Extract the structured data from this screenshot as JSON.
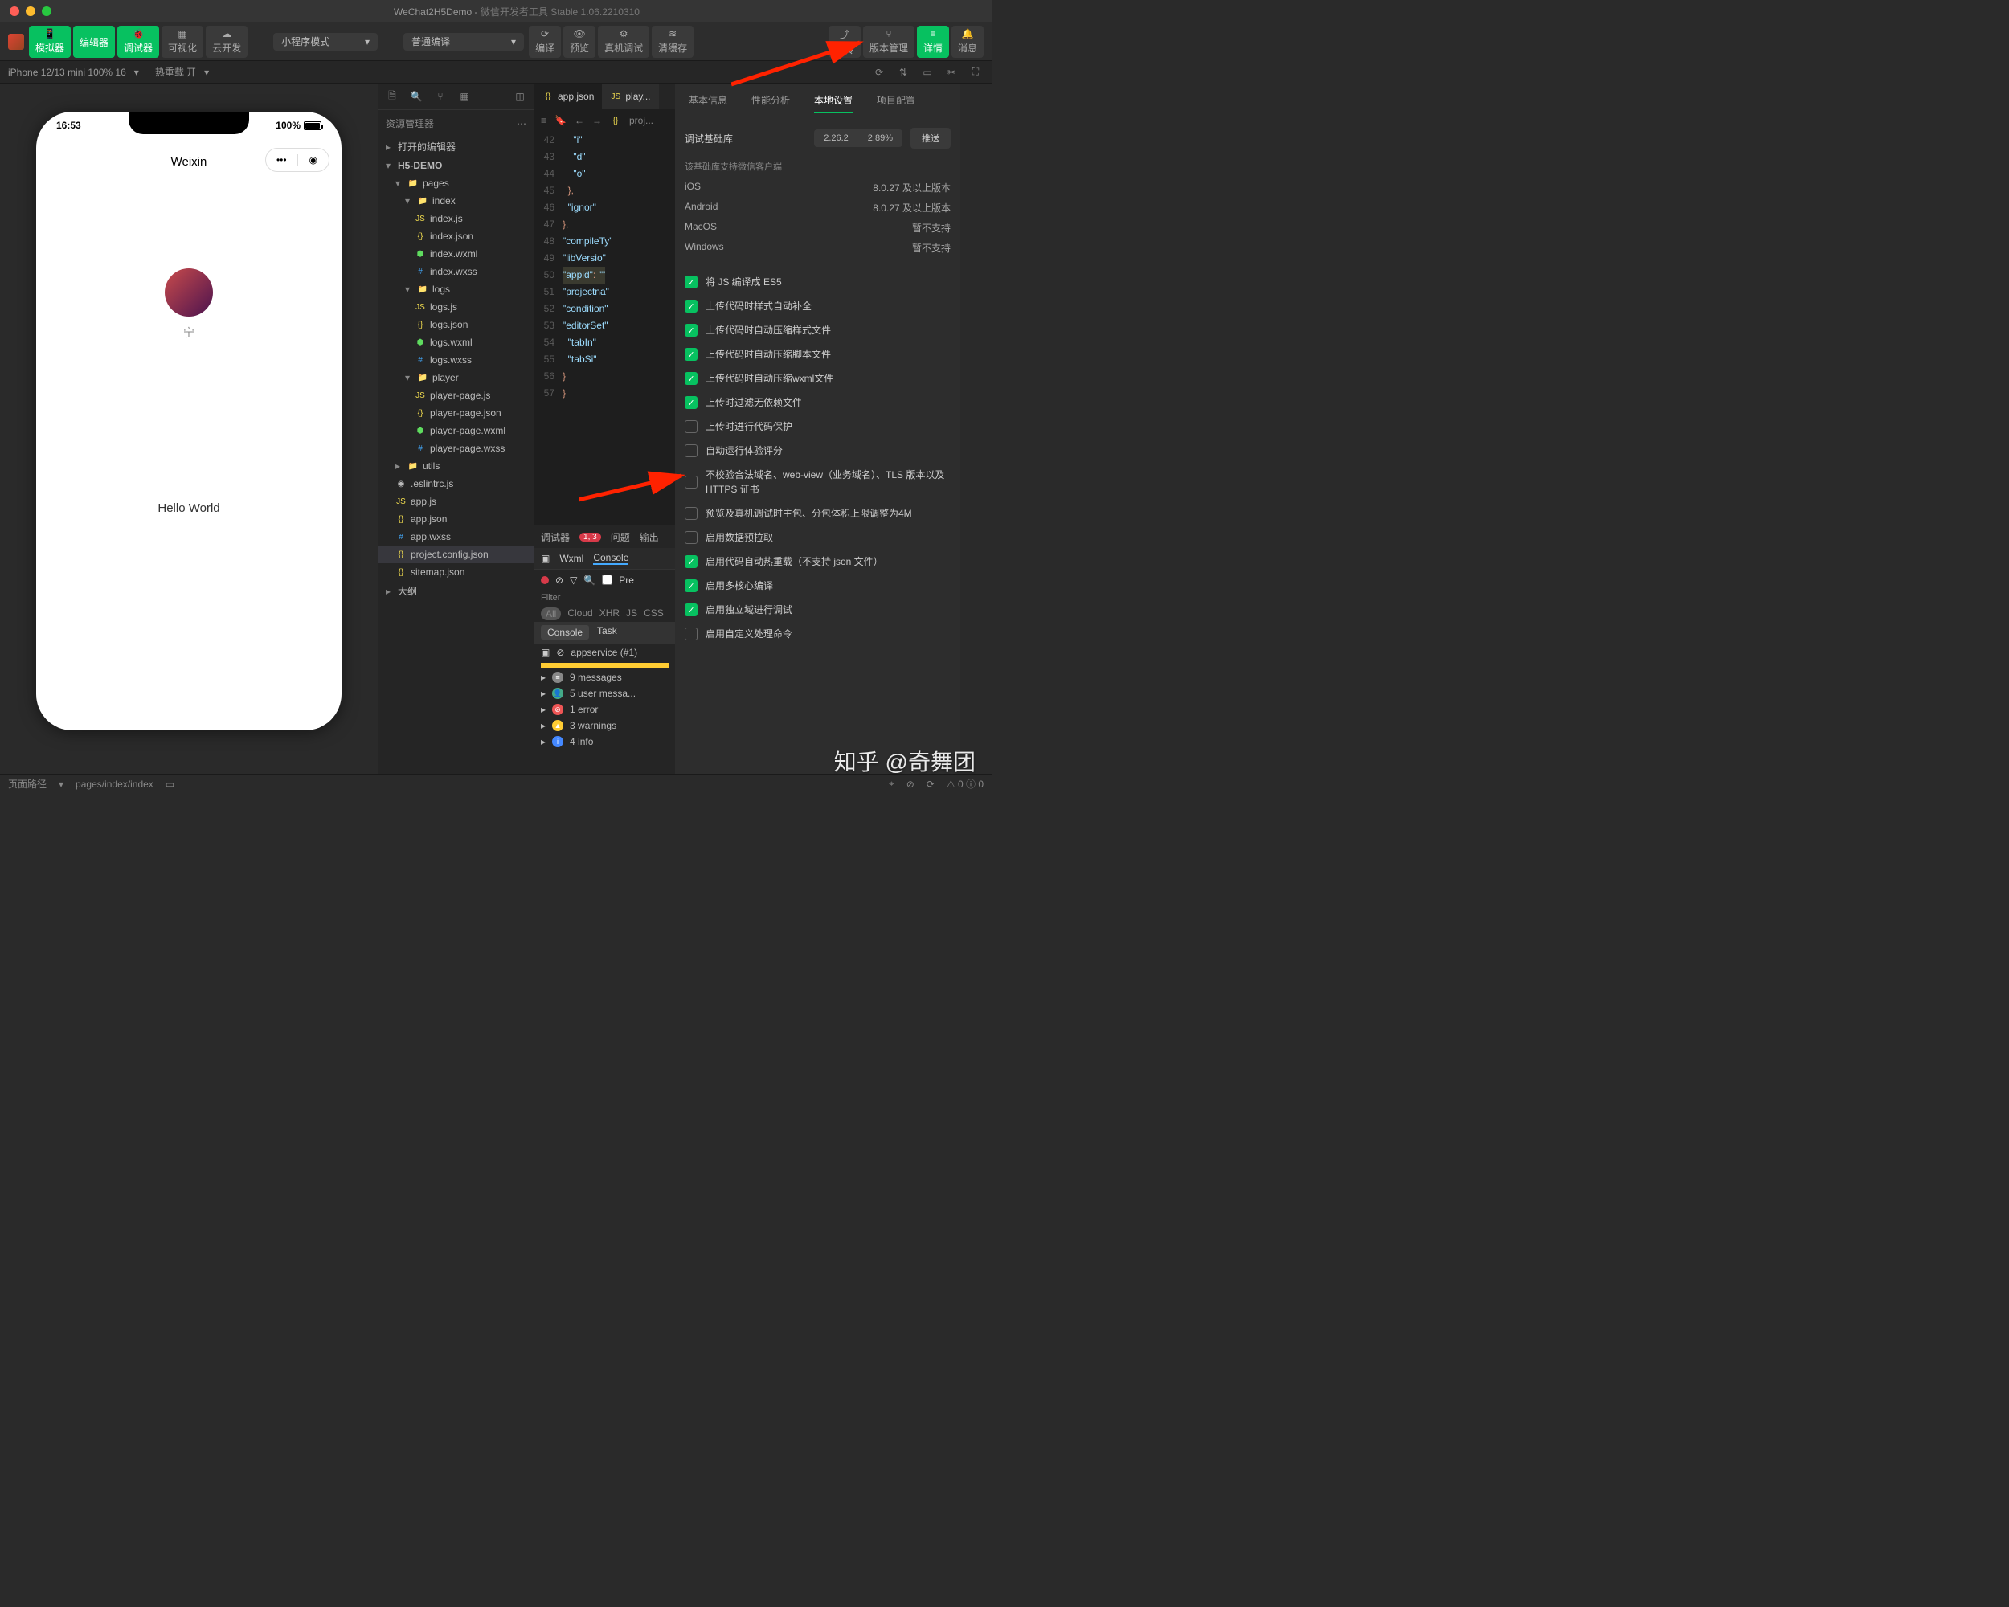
{
  "title": {
    "project": "WeChat2H5Demo",
    "app": "微信开发者工具 Stable 1.06.2210310"
  },
  "toolbar": {
    "left": [
      {
        "l": "模拟器"
      },
      {
        "l": "编辑器"
      },
      {
        "l": "调试器"
      },
      {
        "l": "可视化"
      },
      {
        "l": "云开发"
      }
    ],
    "mode": "小程序模式",
    "compile": "普通编译",
    "mid": [
      {
        "l": "编译"
      },
      {
        "l": "预览"
      },
      {
        "l": "真机调试"
      },
      {
        "l": "清缓存"
      }
    ],
    "right": [
      {
        "l": "上传"
      },
      {
        "l": "版本管理"
      },
      {
        "l": "详情"
      },
      {
        "l": "消息"
      }
    ]
  },
  "subbar": {
    "device": "iPhone 12/13 mini 100% 16",
    "hot": "热重载 开"
  },
  "phone": {
    "time": "16:53",
    "battery": "100%",
    "nav": "Weixin",
    "nick": "宁",
    "hello": "Hello World"
  },
  "explorer": {
    "title": "资源管理器",
    "open": "打开的编辑器",
    "root": "H5-DEMO",
    "outline": "大纲",
    "tree": [
      {
        "n": "pages",
        "t": "folder",
        "i": 1,
        "exp": true
      },
      {
        "n": "index",
        "t": "folder",
        "i": 2,
        "exp": true
      },
      {
        "n": "index.js",
        "t": "js",
        "i": 3
      },
      {
        "n": "index.json",
        "t": "json",
        "i": 3
      },
      {
        "n": "index.wxml",
        "t": "wxml",
        "i": 3
      },
      {
        "n": "index.wxss",
        "t": "wxss",
        "i": 3
      },
      {
        "n": "logs",
        "t": "folder",
        "i": 2,
        "exp": true
      },
      {
        "n": "logs.js",
        "t": "js",
        "i": 3
      },
      {
        "n": "logs.json",
        "t": "json",
        "i": 3
      },
      {
        "n": "logs.wxml",
        "t": "wxml",
        "i": 3
      },
      {
        "n": "logs.wxss",
        "t": "wxss",
        "i": 3
      },
      {
        "n": "player",
        "t": "folder",
        "i": 2,
        "exp": true
      },
      {
        "n": "player-page.js",
        "t": "js",
        "i": 3
      },
      {
        "n": "player-page.json",
        "t": "json",
        "i": 3
      },
      {
        "n": "player-page.wxml",
        "t": "wxml",
        "i": 3
      },
      {
        "n": "player-page.wxss",
        "t": "wxss",
        "i": 3
      },
      {
        "n": "utils",
        "t": "folder",
        "i": 1,
        "exp": false
      },
      {
        "n": ".eslintrc.js",
        "t": "eslint",
        "i": 1
      },
      {
        "n": "app.js",
        "t": "js",
        "i": 1
      },
      {
        "n": "app.json",
        "t": "json",
        "i": 1
      },
      {
        "n": "app.wxss",
        "t": "wxss",
        "i": 1
      },
      {
        "n": "project.config.json",
        "t": "json",
        "i": 1,
        "sel": true
      },
      {
        "n": "sitemap.json",
        "t": "json",
        "i": 1
      }
    ]
  },
  "editor": {
    "tabs": [
      {
        "n": "app.json"
      },
      {
        "n": "play..."
      }
    ],
    "crumb": "proj...",
    "lines": [
      {
        "g": 42,
        "t": "    \"i"
      },
      {
        "g": 43,
        "t": "    \"d"
      },
      {
        "g": 44,
        "t": "    \"o"
      },
      {
        "g": 45,
        "t": "  },"
      },
      {
        "g": 46,
        "t": "  \"ignor"
      },
      {
        "g": 47,
        "t": "},"
      },
      {
        "g": 48,
        "t": "\"compileTy"
      },
      {
        "g": 49,
        "t": "\"libVersio"
      },
      {
        "g": 50,
        "t": "\"appid\": \"",
        "hl": true
      },
      {
        "g": 51,
        "t": "\"projectna"
      },
      {
        "g": 52,
        "t": "\"condition"
      },
      {
        "g": 53,
        "t": "\"editorSet"
      },
      {
        "g": 54,
        "t": "  \"tabIn"
      },
      {
        "g": 55,
        "t": "  \"tabSi"
      },
      {
        "g": 56,
        "t": "}"
      },
      {
        "g": 57,
        "t": "}"
      }
    ]
  },
  "debugger": {
    "tab": "调试器",
    "badge": "1, 3",
    "issue": "问题",
    "out": "输出",
    "devtabs": [
      "Wxml",
      "Console"
    ],
    "contabs": [
      {
        "n": "Console",
        "act": true
      },
      {
        "n": "Task"
      }
    ],
    "filter": "Filter",
    "cats": [
      "All",
      "Cloud",
      "XHR",
      "JS",
      "CSS"
    ],
    "svc": "appservice (#1)",
    "pre": "Pre",
    "msgs": [
      {
        "ico": "≡",
        "c": "#888",
        "t": "9 messages"
      },
      {
        "ico": "👤",
        "c": "#4a8",
        "t": "5 user messa..."
      },
      {
        "ico": "⊘",
        "c": "#e55",
        "t": "1 error"
      },
      {
        "ico": "▲",
        "c": "#fc3",
        "t": "3 warnings"
      },
      {
        "ico": "i",
        "c": "#48f",
        "t": "4 info"
      }
    ]
  },
  "panel": {
    "tabs": [
      "基本信息",
      "性能分析",
      "本地设置",
      "项目配置"
    ],
    "active": 2,
    "liblabel": "调试基础库",
    "ver": "2.26.2",
    "pct": "2.89%",
    "push": "推送",
    "support": "该基础库支持微信客户端",
    "plats": [
      {
        "n": "iOS",
        "v": "8.0.27 及以上版本"
      },
      {
        "n": "Android",
        "v": "8.0.27 及以上版本"
      },
      {
        "n": "MacOS",
        "v": "暂不支持"
      },
      {
        "n": "Windows",
        "v": "暂不支持"
      }
    ],
    "checks": [
      {
        "on": true,
        "t": "将 JS 编译成 ES5"
      },
      {
        "on": true,
        "t": "上传代码时样式自动补全"
      },
      {
        "on": true,
        "t": "上传代码时自动压缩样式文件"
      },
      {
        "on": true,
        "t": "上传代码时自动压缩脚本文件"
      },
      {
        "on": true,
        "t": "上传代码时自动压缩wxml文件"
      },
      {
        "on": true,
        "t": "上传时过滤无依赖文件"
      },
      {
        "on": false,
        "t": "上传时进行代码保护"
      },
      {
        "on": false,
        "t": "自动运行体验评分"
      },
      {
        "on": false,
        "t": "不校验合法域名、web-view（业务域名）、TLS 版本以及 HTTPS 证书"
      },
      {
        "on": false,
        "t": "预览及真机调试时主包、分包体积上限调整为4M"
      },
      {
        "on": false,
        "t": "启用数据预拉取"
      },
      {
        "on": true,
        "t": "启用代码自动热重载（不支持 json 文件）"
      },
      {
        "on": true,
        "t": "启用多核心编译"
      },
      {
        "on": true,
        "t": "启用独立域进行调试"
      },
      {
        "on": false,
        "t": "启用自定义处理命令"
      }
    ]
  },
  "footer": {
    "path": "页面路径",
    "val": "pages/index/index"
  },
  "watermark": "知乎 @奇舞团"
}
